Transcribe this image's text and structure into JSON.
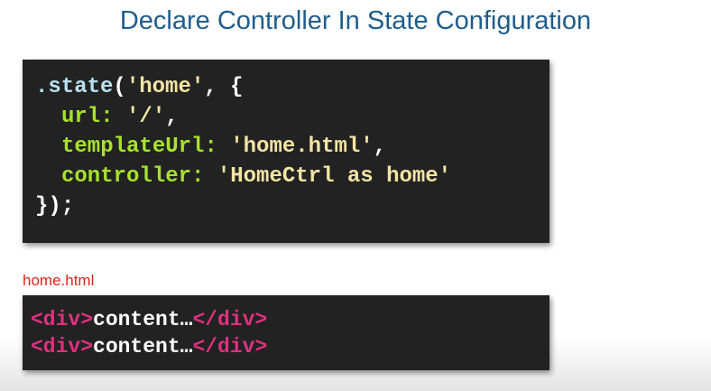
{
  "slide": {
    "title": "Declare Controller In State Configuration"
  },
  "js_code": {
    "line1": {
      "dot_state": ".state",
      "open_paren": "(",
      "home_str": "'home'",
      "comma_brace": ", {"
    },
    "line2": {
      "key": "url",
      "colon": ":",
      "value": "'/'",
      "comma": ","
    },
    "line3": {
      "key": "templateUrl",
      "colon": ":",
      "value": "'home.html'",
      "comma": ","
    },
    "line4": {
      "key": "controller",
      "colon": ":",
      "value": "'HomeCtrl as home'"
    },
    "line5": {
      "close": "});"
    }
  },
  "html_file": {
    "label": "home.html",
    "lines": [
      {
        "open_tag": "<div>",
        "content": "content…",
        "close_tag": "</div>"
      },
      {
        "open_tag": "<div>",
        "content": "content…",
        "close_tag": "</div>"
      }
    ]
  },
  "colors": {
    "title": "#1f5d8c",
    "code_background": "#222222",
    "function": "#b9e0f0",
    "string": "#f2e4a3",
    "key": "#a6e22e",
    "tag": "#e0307f",
    "file_label": "#d9261c"
  }
}
